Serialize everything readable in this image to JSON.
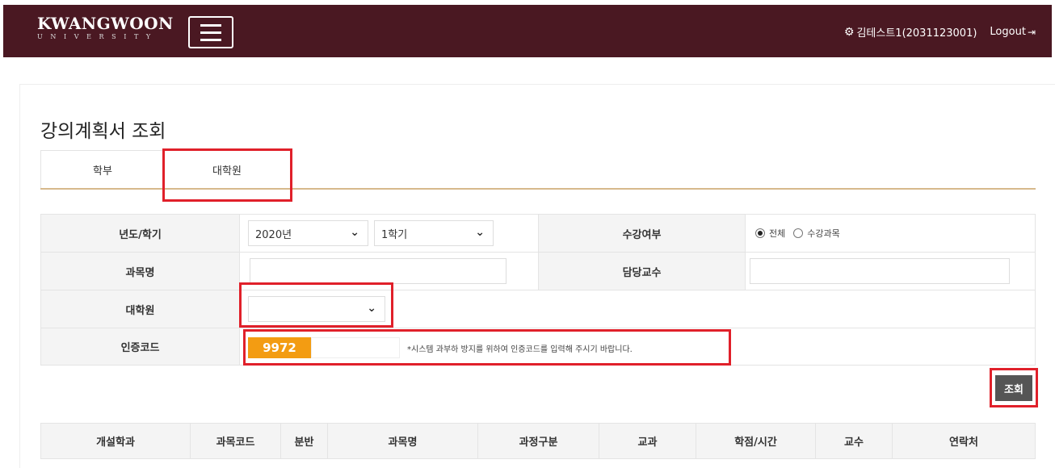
{
  "header": {
    "logo_main": "KWANGWOON",
    "logo_sub": "UNIVERSITY",
    "user_icon": "gear-icon",
    "user_label": "김테스트1(2031123001)",
    "logout_label": "Logout",
    "logout_icon": "sign-out-icon",
    "bar_color": "#4a1822"
  },
  "page": {
    "title": "강의계획서 조회"
  },
  "tabs": [
    {
      "label": "학부"
    },
    {
      "label": "대학원"
    }
  ],
  "form": {
    "year_term_label": "년도/학기",
    "year_value": "2020년",
    "term_value": "1학기",
    "enroll_label": "수강여부",
    "enroll_options": [
      "전체",
      "수강과목"
    ],
    "enroll_selected": "전체",
    "subject_label": "과목명",
    "subject_value": "",
    "professor_label": "담당교수",
    "professor_value": "",
    "grad_school_label": "대학원",
    "grad_school_value": "",
    "auth_label": "인증코드",
    "auth_code": "9972",
    "auth_input_value": "",
    "auth_note": "*시스템 과부하 방지를 위하여 인증코드를 입력해 주시기 바랍니다.",
    "search_button": "조회"
  },
  "results": {
    "columns": [
      "개설학과",
      "과목코드",
      "분반",
      "과목명",
      "과정구분",
      "교과",
      "학점/시간",
      "교수",
      "연락처"
    ]
  },
  "colors": {
    "accent_orange": "#f39c12",
    "highlight_red": "#e0202a",
    "tab_underline": "#d7b98c"
  }
}
